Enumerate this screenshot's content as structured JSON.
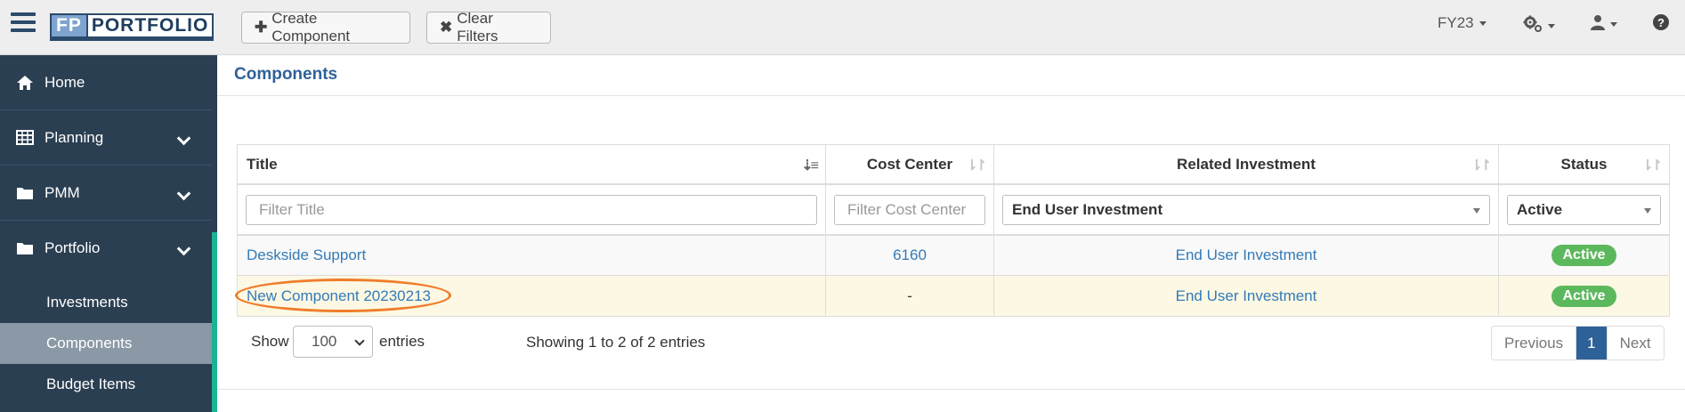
{
  "app": {
    "logo_fp": "FP",
    "logo_name": "PORTFOLIO"
  },
  "toolbar": {
    "create_label": "Create Component",
    "clear_label": "Clear Filters",
    "fiscal_year": "FY23"
  },
  "icons": {
    "menu": "hamburger-icon",
    "plus": "plus-icon",
    "clear": "close-icon",
    "settings": "gears-icon",
    "user": "user-icon",
    "help": "question-icon",
    "home": "home-icon",
    "planning": "table-icon",
    "folder": "folder-icon"
  },
  "sidebar": {
    "items": [
      {
        "label": "Home"
      },
      {
        "label": "Planning"
      },
      {
        "label": "PMM"
      },
      {
        "label": "Portfolio"
      }
    ],
    "subitems": [
      {
        "label": "Investments",
        "active": false
      },
      {
        "label": "Components",
        "active": true
      },
      {
        "label": "Budget Items",
        "active": false
      }
    ]
  },
  "main": {
    "page_title": "Components"
  },
  "table": {
    "columns": [
      "Title",
      "Cost Center",
      "Related Investment",
      "Status"
    ],
    "filters": {
      "title_placeholder": "Filter Title",
      "cost_center_placeholder": "Filter Cost Center",
      "investment_selected": "End User Investment",
      "status_selected": "Active"
    },
    "rows": [
      {
        "title": "Deskside Support",
        "cost_center": "6160",
        "investment": "End User Investment",
        "status": "Active"
      },
      {
        "title": "New Component 20230213",
        "cost_center": "-",
        "investment": "End User Investment",
        "status": "Active"
      }
    ]
  },
  "footer": {
    "show_label": "Show",
    "page_size": "100",
    "entries_label": "entries",
    "info": "Showing 1 to 2 of 2 entries",
    "prev": "Previous",
    "current_page": "1",
    "next": "Next"
  },
  "colors": {
    "nav_bg": "#2b3f52",
    "accent": "#1ab394",
    "link": "#337ab7",
    "badge": "#5cb85c",
    "highlight_circle": "#f07c2a"
  }
}
